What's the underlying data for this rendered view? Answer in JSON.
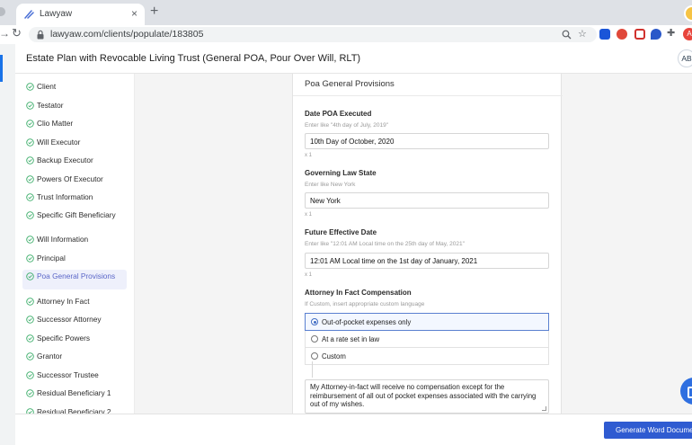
{
  "browser": {
    "tab_title": "Lawyaw",
    "tab_close": "×",
    "new_tab": "+",
    "url": "lawyaw.com/clients/populate/183805",
    "profile_initials": "A"
  },
  "header": {
    "title": "Estate Plan with Revocable Living Trust (General POA, Pour Over Will, RLT)",
    "avatar_initials": "AB"
  },
  "sidebar": {
    "items": [
      {
        "label": "Client",
        "active": false
      },
      {
        "label": "Testator",
        "active": false
      },
      {
        "label": "Clio Matter",
        "active": false
      },
      {
        "label": "Will Executor",
        "active": false
      },
      {
        "label": "Backup Executor",
        "active": false
      },
      {
        "label": "Powers Of Executor",
        "active": false
      },
      {
        "label": "Trust Information",
        "active": false
      },
      {
        "label": "Specific Gift Beneficiary",
        "active": false
      },
      {
        "label": "Will Information",
        "active": false
      },
      {
        "label": "Principal",
        "active": false
      },
      {
        "label": "Poa General Provisions",
        "active": true
      },
      {
        "label": "Attorney In Fact",
        "active": false
      },
      {
        "label": "Successor Attorney",
        "active": false
      },
      {
        "label": "Specific Powers",
        "active": false
      },
      {
        "label": "Grantor",
        "active": false
      },
      {
        "label": "Successor Trustee",
        "active": false
      },
      {
        "label": "Residual Beneficiary 1",
        "active": false
      },
      {
        "label": "Residual Beneficiary 2",
        "active": false
      }
    ]
  },
  "form": {
    "section_title": "Poa General Provisions",
    "fields": [
      {
        "label": "Date POA Executed",
        "help": "Enter like \"4th day of July, 2019\"",
        "value": "10th Day of October, 2020",
        "multiplier": "x 1"
      },
      {
        "label": "Governing Law State",
        "help": "Enter like New York",
        "value": "New York",
        "multiplier": "x 1"
      },
      {
        "label": "Future Effective Date",
        "help": "Enter like \"12:01 AM Local time on the 25th day of May, 2021\"",
        "value": "12:01 AM Local time on the 1st day of January, 2021",
        "multiplier": "x 1"
      }
    ],
    "compensation": {
      "label": "Attorney In Fact Compensation",
      "help": "If Custom, insert appropriate custom language",
      "options": [
        {
          "label": "Out-of-pocket expenses only",
          "selected": true
        },
        {
          "label": "At a rate set in law",
          "selected": false
        },
        {
          "label": "Custom",
          "selected": false
        }
      ],
      "text": "My Attorney-in-fact will receive no compensation except for the reimbursement of all out of pocket expenses associated with the carrying out of my wishes."
    }
  },
  "footer": {
    "generate_label": "Generate Word Document"
  },
  "colors": {
    "accent": "#2f5bd1",
    "check": "#3cad6a",
    "active_nav_bg": "#eef0fb"
  }
}
